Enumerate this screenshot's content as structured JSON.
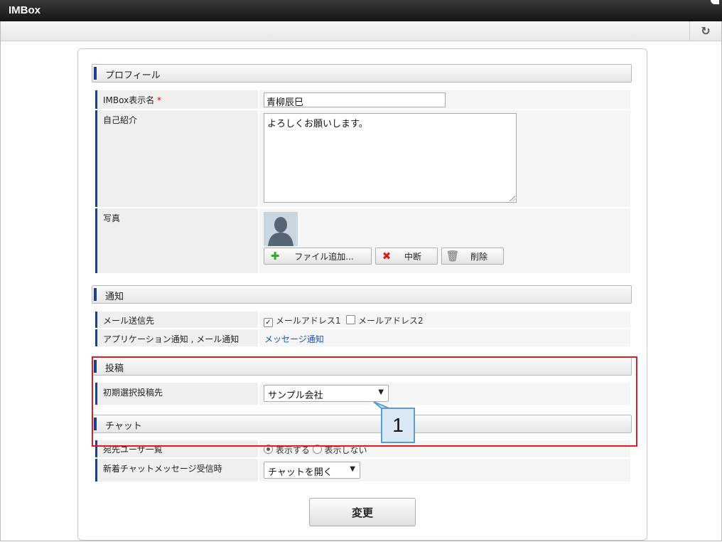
{
  "window": {
    "title": "IMBox"
  },
  "profile": {
    "heading": "プロフィール",
    "display_name_label": "IMBox表示名",
    "required_mark": "*",
    "display_name_value": "青柳辰巳",
    "intro_label": "自己紹介",
    "intro_value": "よろしくお願いします。",
    "photo_label": "写真",
    "add_file_button": "ファイル追加...",
    "cancel_button": "中断",
    "delete_button": "削除"
  },
  "notification": {
    "heading": "通知",
    "mail_label": "メール送信先",
    "mail_option1": "メールアドレス1",
    "mail_option1_checked": true,
    "mail_option2": "メールアドレス2",
    "mail_option2_checked": false,
    "app_label": "アプリケーション通知 , メール通知",
    "app_link": "メッセージ通知"
  },
  "post": {
    "heading": "投稿",
    "default_target_label": "初期選択投稿先",
    "default_target_value": "サンプル会社"
  },
  "chat": {
    "heading": "チャット",
    "recipients_label": "宛先ユーザ一覧",
    "show_option": "表示する",
    "hide_option": "表示しない",
    "selected": "表示する",
    "new_message_label": "新着チャットメッセージ受信時",
    "new_message_value": "チャットを開く"
  },
  "submit_label": "変更",
  "annotation": {
    "number": "1",
    "color": "#e01b24",
    "callout_color": "#5b9bd5"
  }
}
